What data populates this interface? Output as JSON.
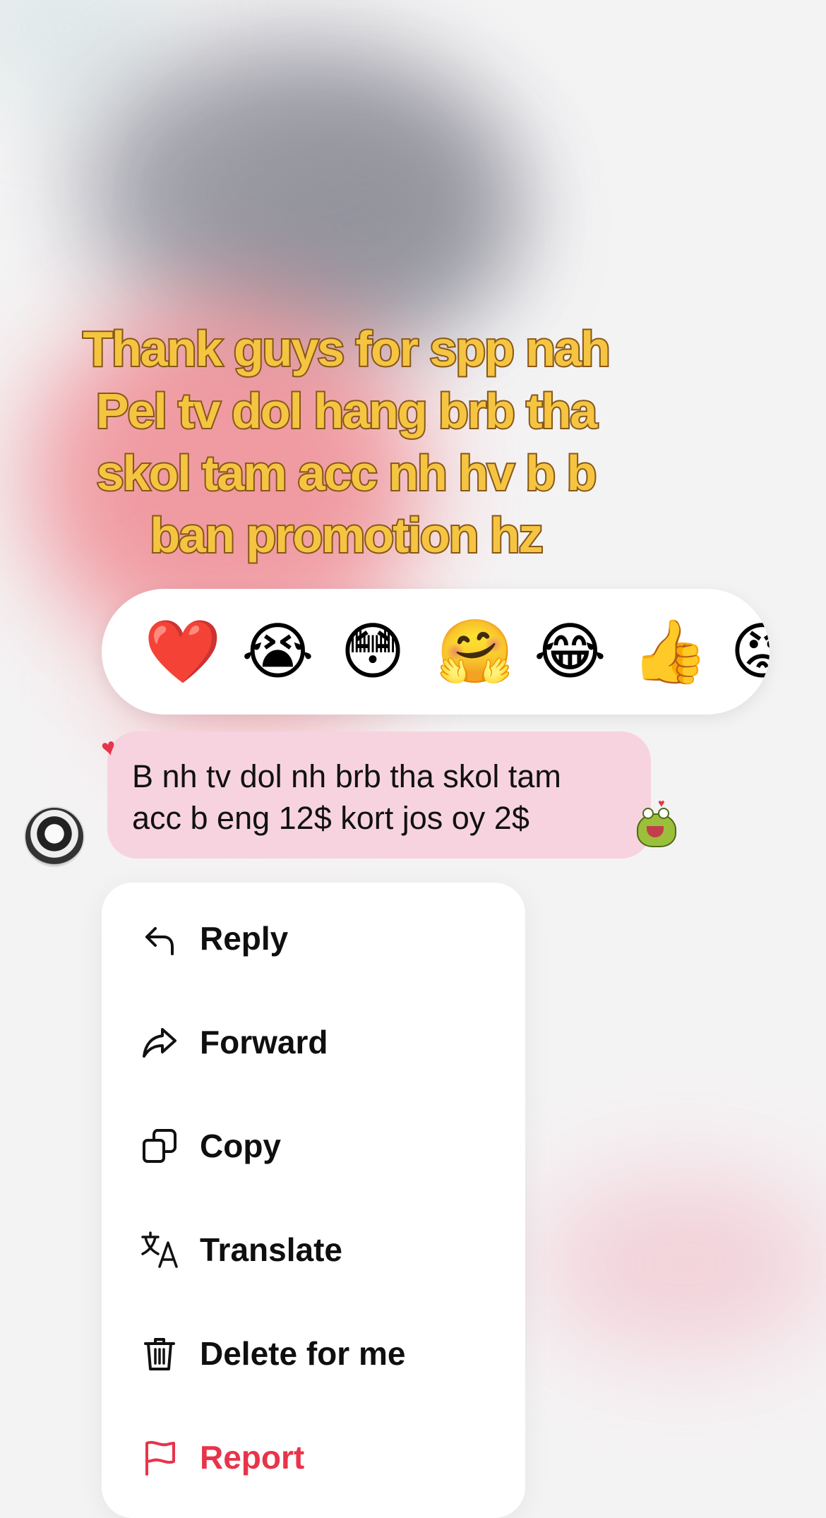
{
  "caption": {
    "lines": [
      "Thank guys for spp nah",
      "Pel tv dol hang brb tha",
      "skol tam acc nh hv b b",
      "ban promotion hz"
    ]
  },
  "reactions": [
    {
      "emoji": "❤️",
      "name": "heart"
    },
    {
      "emoji": "😭",
      "name": "loudly-crying"
    },
    {
      "emoji": "😳",
      "name": "flushed"
    },
    {
      "emoji": "🤗",
      "name": "hugging"
    },
    {
      "emoji": "😂",
      "name": "tears-of-joy"
    },
    {
      "emoji": "👍",
      "name": "thumbs-up"
    },
    {
      "emoji": "😡",
      "name": "angry"
    }
  ],
  "message": {
    "lines": [
      "B nh tv dol nh brb tha skol tam",
      "acc b eng 12$ kort jos oy 2$"
    ],
    "reaction": "♥"
  },
  "menu": {
    "items": [
      {
        "label": "Reply",
        "icon": "reply-icon"
      },
      {
        "label": "Forward",
        "icon": "forward-icon"
      },
      {
        "label": "Copy",
        "icon": "copy-icon"
      },
      {
        "label": "Translate",
        "icon": "translate-icon"
      },
      {
        "label": "Delete for me",
        "icon": "trash-icon"
      },
      {
        "label": "Report",
        "icon": "flag-icon"
      }
    ]
  },
  "colors": {
    "bubble": "#f7d3e0",
    "danger": "#e8344a",
    "caption_fill": "#f5c542",
    "caption_stroke": "#8a5a1c"
  }
}
